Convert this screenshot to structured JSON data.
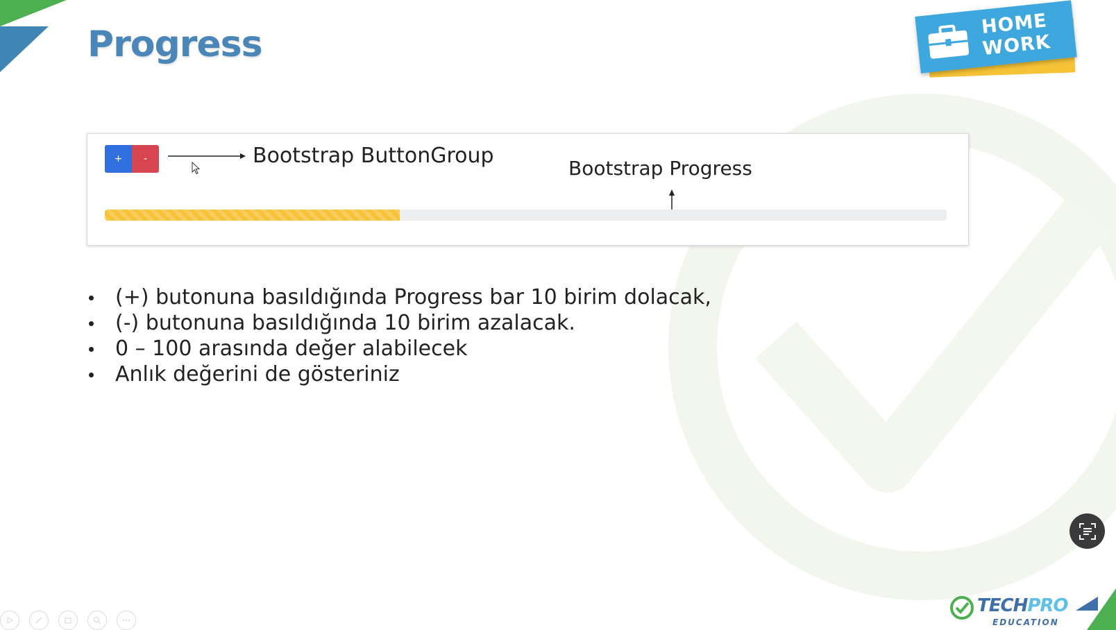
{
  "slide": {
    "title": "Progress"
  },
  "badge": {
    "line1": "HOME",
    "line2": "WORK",
    "icon": "briefcase-icon"
  },
  "demo": {
    "plus_label": "+",
    "minus_label": "-",
    "buttongroup_label": "Bootstrap ButtonGroup",
    "progress_label": "Bootstrap Progress",
    "progress_percent": 35,
    "progress_color": "#f5c335"
  },
  "bullets": [
    "(+) butonuna basıldığında Progress bar 10 birim dolacak,",
    "(-) butonuna basıldığında 10 birim azalacak.",
    "0 – 100 arasında değer alabilecek",
    "Anlık değerini de gösteriniz"
  ],
  "logo": {
    "tech": "TECH",
    "pro": "PRO",
    "sub": "EDUCATION"
  },
  "colors": {
    "title": "#4a86b8",
    "plus_button": "#2f6fdf",
    "minus_button": "#d64550",
    "accent_green": "#4cb050"
  }
}
